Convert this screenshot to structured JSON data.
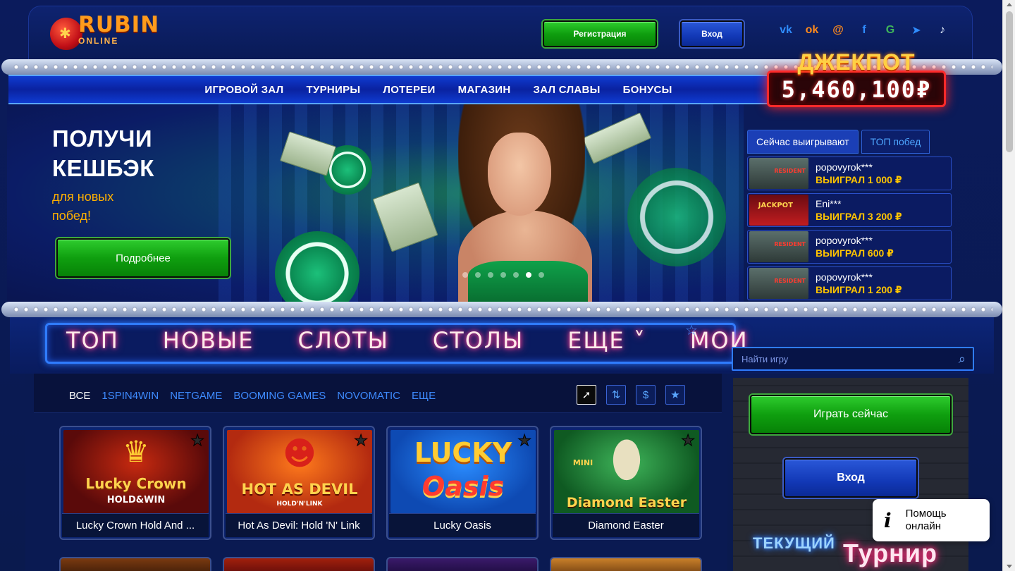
{
  "header": {
    "logo_text": "RUBIN",
    "logo_sub": "ONLINE",
    "register_label": "Регистрация",
    "login_label": "Вход",
    "socials": [
      {
        "icon": "vk-icon",
        "glyph": "vk"
      },
      {
        "icon": "odnoklassniki-icon",
        "glyph": "ok"
      },
      {
        "icon": "mail-icon",
        "glyph": "@"
      },
      {
        "icon": "facebook-icon",
        "glyph": "f"
      },
      {
        "icon": "google-icon",
        "glyph": "G"
      },
      {
        "icon": "telegram-icon",
        "glyph": "➤"
      },
      {
        "icon": "tiktok-icon",
        "glyph": "♪"
      }
    ]
  },
  "nav": {
    "items": [
      "ИГРОВОЙ ЗАЛ",
      "ТУРНИРЫ",
      "ЛОТЕРЕИ",
      "МАГАЗИН",
      "ЗАЛ СЛАВЫ",
      "БОНУСЫ"
    ]
  },
  "jackpot": {
    "title": "ДЖЕКПОТ",
    "value": "5,460,100₽"
  },
  "banner": {
    "title_line1": "ПОЛУЧИ",
    "title_line2": "КЕШБЭК",
    "sub_line1": "для новых",
    "sub_line2": "побед!",
    "button_label": "Подробнее",
    "slide_count": 7,
    "active_slide": 6
  },
  "winners": {
    "tab_active": "Сейчас выигрывают",
    "tab_inactive": "ТОП побед",
    "rows": [
      {
        "thumb_tag": "RESIDENT",
        "name": "popovyrok***",
        "amount": "ВЫИГРАЛ 1 000 ₽"
      },
      {
        "thumb_tag": "JACKPOT",
        "name": "Eni***",
        "amount": "ВЫИГРАЛ 3 200 ₽"
      },
      {
        "thumb_tag": "RESIDENT",
        "name": "popovyrok***",
        "amount": "ВЫИГРАЛ 600 ₽"
      },
      {
        "thumb_tag": "RESIDENT",
        "name": "popovyrok***",
        "amount": "ВЫИГРАЛ 1 200 ₽"
      }
    ]
  },
  "categories": {
    "items": [
      "ТОП",
      "НОВЫЕ",
      "СЛОТЫ",
      "СТОЛЫ",
      "ЕЩЕ ˅",
      "МОИ"
    ],
    "star_glyph": "☆"
  },
  "search": {
    "placeholder": "Найти игру"
  },
  "filters": {
    "items": [
      "ВСЕ",
      "1SPIN4WIN",
      "NETGAME",
      "BOOMING GAMES",
      "NOVOMATIC",
      "ЕЩЕ"
    ],
    "active_index": 0,
    "sort_icons": [
      {
        "name": "cursor-sort-icon",
        "glyph": "➚"
      },
      {
        "name": "alphabet-sort-icon",
        "glyph": "⇅"
      },
      {
        "name": "dollar-sort-icon",
        "glyph": "$"
      },
      {
        "name": "favorite-sort-icon",
        "glyph": "★"
      }
    ]
  },
  "games": [
    {
      "name": "Lucky Crown Hold And ...",
      "art": "Lucky Crown",
      "art2": "HOLD&WIN",
      "bg": "#5a0a0a",
      "accent": "#ffcc33"
    },
    {
      "name": "Hot As Devil: Hold 'N' Link",
      "art": "HOT AS DEVIL",
      "art2": "HOLD'N'LINK",
      "bg": "#b32a10",
      "accent": "#ffd34d"
    },
    {
      "name": "Lucky Oasis",
      "art": "LUCKY",
      "art2": "Oasis",
      "bg": "#0e4ab3",
      "accent": "#ffcc33"
    },
    {
      "name": "Diamond Easter",
      "art": "MINI",
      "art2": "Diamond Easter",
      "bg": "#0f5a22",
      "accent": "#ffd34d"
    }
  ],
  "side": {
    "play_label": "Играть сейчас",
    "login_label": "Вход",
    "tourney_line1": "ТЕКУЩИЙ",
    "tourney_line2": "Турнир"
  },
  "help": {
    "icon_glyph": "i",
    "line1": "Помощь",
    "line2": "онлайн"
  }
}
